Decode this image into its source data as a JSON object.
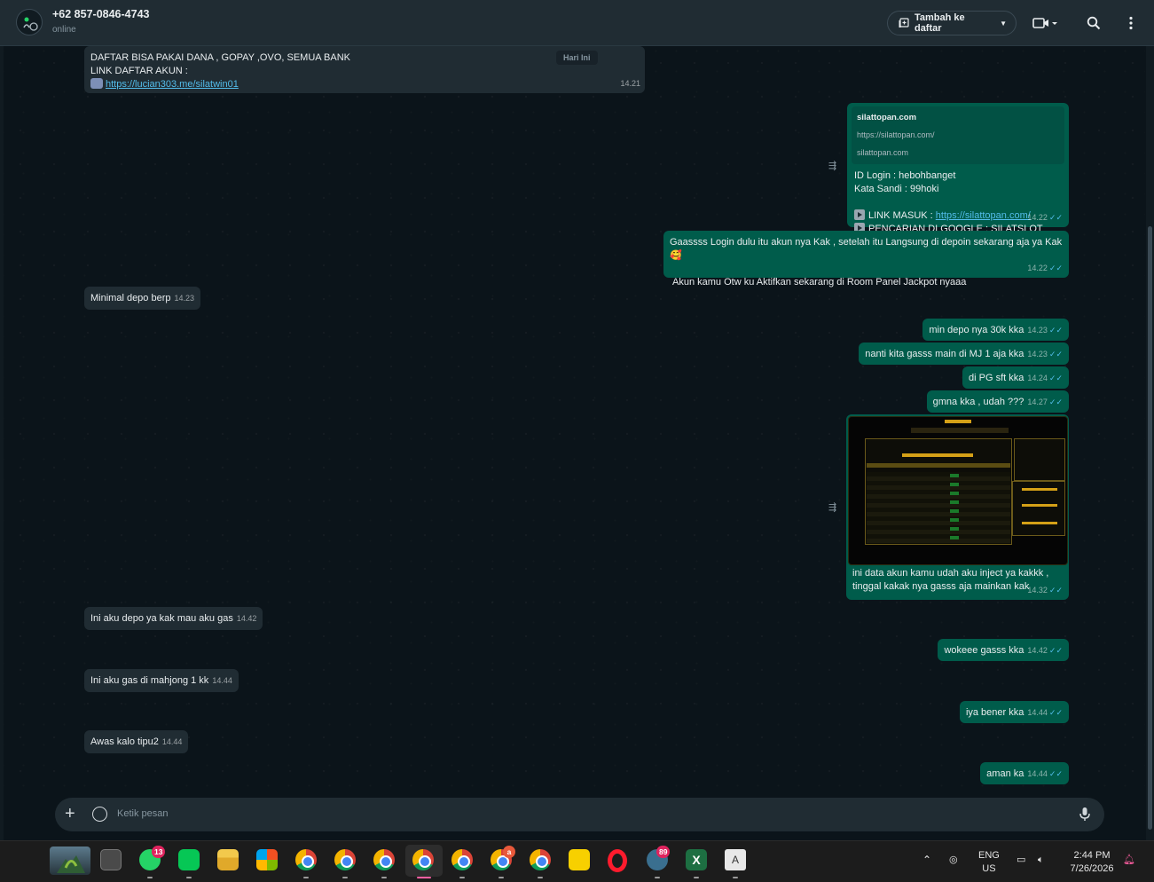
{
  "header": {
    "contact_name": "+62 857-0846-4743",
    "status": "online",
    "add_to_list_label": "Tambah ke daftar"
  },
  "date_chip": "Hari Ini",
  "messages": [
    {
      "dir": "in",
      "lines": [
        "DAFTAR BISA PAKAI DANA , GOPAY ,OVO, SEMUA BANK",
        "LINK DAFTAR AKUN :"
      ],
      "link": "https://lucian303.me/silatwin01",
      "time": "14.21"
    },
    {
      "dir": "out",
      "preview": {
        "title": "silattopan.com",
        "url": "https://silattopan.com/",
        "host": "silattopan.com"
      },
      "lines": [
        "ID Login : hebohbanget",
        "Kata Sandi : 99hoki"
      ],
      "link_label": "LINK MASUK  : ",
      "link": "https://silattopan.com/",
      "search_line": "PENCARIAN DI GOOGLE : SILATSLOT",
      "time": "14.22"
    },
    {
      "dir": "out",
      "line1": "Gaassss Login dulu itu akun nya Kak  , setelah itu Langsung di depoin sekarang aja ya Kak",
      "emoji": "🥰",
      "line2": "Akun kamu Otw ku Aktifkan sekarang di Room Panel Jackpot nyaaa",
      "time": "14.22"
    },
    {
      "dir": "in",
      "text": "Minimal depo berp",
      "time": "14.23"
    },
    {
      "dir": "out",
      "text": "min depo nya 30k kka",
      "time": "14.23"
    },
    {
      "dir": "out",
      "text": "nanti kita gasss main di MJ 1 aja kka",
      "time": "14.23"
    },
    {
      "dir": "out",
      "text": "di PG sft kka",
      "time": "14.24"
    },
    {
      "dir": "out",
      "text": "gmna kka , udah ???",
      "time": "14.27"
    },
    {
      "dir": "out",
      "image_caption": [
        "ini data akun kamu udah aku inject ya kakkk ,",
        "tinggal kakak nya gasss aja mainkan kak"
      ],
      "time": "14.32"
    },
    {
      "dir": "in",
      "text": "Ini aku depo ya kak mau aku gas",
      "time": "14.42"
    },
    {
      "dir": "out",
      "text": "wokeee gasss kka",
      "time": "14.42"
    },
    {
      "dir": "in",
      "text": "Ini aku gas di mahjong 1 kk",
      "time": "14.44"
    },
    {
      "dir": "out",
      "text": "iya bener kka",
      "time": "14.44"
    },
    {
      "dir": "in",
      "text": "Awas kalo tipu2",
      "time": "14.44"
    },
    {
      "dir": "out",
      "text": "aman ka",
      "time": "14.44"
    }
  ],
  "composer": {
    "placeholder": "Ketik pesan"
  },
  "taskbar": {
    "whatsapp_badge": "13",
    "chrome_badge": "a",
    "app_badge": "89",
    "lang": "ENG",
    "region": "US",
    "time": "2:44 PM",
    "date": "7/26/2026"
  }
}
